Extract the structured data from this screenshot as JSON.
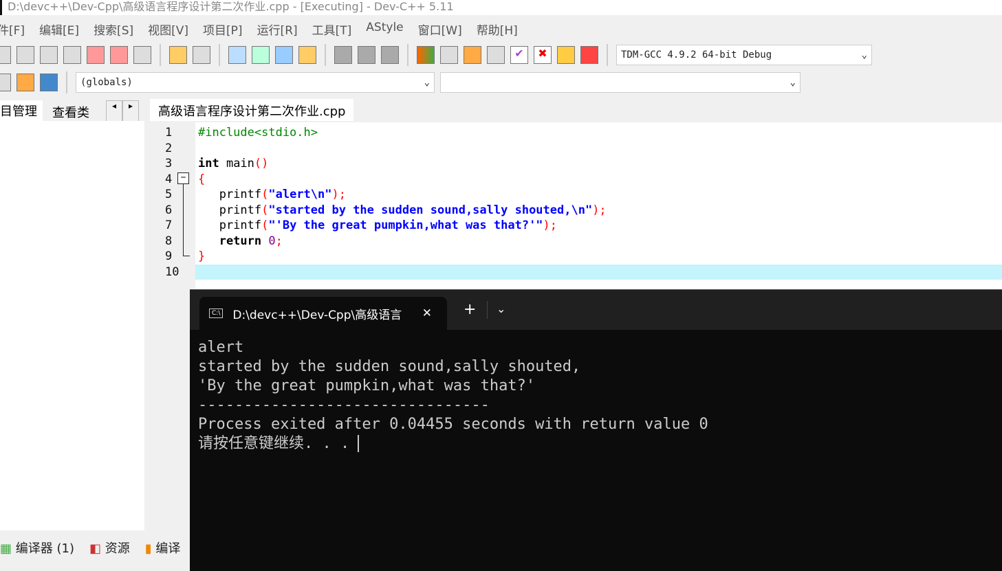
{
  "title": "D:\\devc++\\Dev-Cpp\\高级语言程序设计第二次作业.cpp - [Executing] - Dev-C++ 5.11",
  "menu": [
    "件[F]",
    "编辑[E]",
    "搜索[S]",
    "视图[V]",
    "项目[P]",
    "运行[R]",
    "工具[T]",
    "AStyle",
    "窗口[W]",
    "帮助[H]"
  ],
  "compiler_select": "TDM-GCC 4.9.2 64-bit Debug",
  "scope_select": "(globals)",
  "left_tabs": [
    "目管理",
    "查看类"
  ],
  "editor_tab": "高级语言程序设计第二次作业.cpp",
  "line_numbers": [
    "1",
    "2",
    "3",
    "4",
    "5",
    "6",
    "7",
    "8",
    "9",
    "10"
  ],
  "code": {
    "l1": "#include<stdio.h>",
    "l3a": "int",
    " l3b": " main",
    "l3c": "()",
    "l4": "{",
    "l5a": "   printf",
    "l5b": "(",
    "l5c": "\"alert\\n\"",
    "l5d": ");",
    "l6a": "   printf",
    "l6c": "\"started by the sudden sound,sally shouted,\\n\"",
    "l7a": "   printf",
    "l7c": "\"'By the great pumpkin,what was that?'\"",
    "l8a": "   return",
    "l8b": " 0",
    "l8c": ";",
    "l9": "}"
  },
  "terminal": {
    "tab_title": "D:\\devc++\\Dev-Cpp\\高级语言",
    "output": [
      "alert",
      "started by the sudden sound,sally shouted,",
      "'By the great pumpkin,what was that?'",
      "--------------------------------",
      "Process exited after 0.04455 seconds with return value 0",
      "请按任意键继续. . ."
    ]
  },
  "bottom_tabs": [
    "编译器 (1)",
    "资源",
    "编译"
  ]
}
